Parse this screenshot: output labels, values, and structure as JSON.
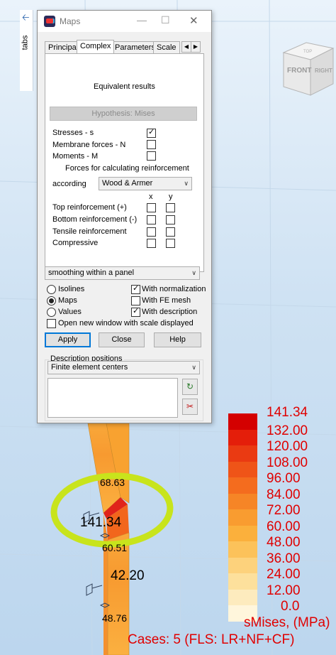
{
  "sidebar": {
    "tabs_label": "tabs"
  },
  "viewcube": {
    "front": "FRONT",
    "right": "RIGHT",
    "top": "TOP"
  },
  "window": {
    "title": "Maps"
  },
  "tabs": [
    "Principal",
    "Complex",
    "Parameters",
    "Scale"
  ],
  "complex": {
    "equivalent_results": "Equivalent results",
    "hypothesis": "Hypothesis: Mises",
    "stresses": "Stresses - s",
    "membrane": "Membrane forces - N",
    "moments": "Moments - M",
    "forces_reinf": "Forces for calculating reinforcement",
    "according": "according",
    "method": "Wood & Armer",
    "col_x": "x",
    "col_y": "y",
    "top_reinf": "Top reinforcement (+)",
    "bottom_reinf": "Bottom reinforcement (-)",
    "tensile_reinf": "Tensile reinforcement",
    "compressive": "Compressive"
  },
  "smoothing": "smoothing within a panel",
  "options": {
    "isolines": "Isolines",
    "maps": "Maps",
    "values": "Values",
    "with_normalization": "With normalization",
    "with_fe_mesh": "With FE mesh",
    "with_description": "With description",
    "open_new_window": "Open new window with scale displayed"
  },
  "buttons": {
    "apply": "Apply",
    "close": "Close",
    "help": "Help"
  },
  "description": {
    "caption": "Description positions",
    "position": "Finite element centers"
  },
  "values_on_model": {
    "v1": "68.63",
    "v2": "141.34",
    "v3": "60.51",
    "v4": "42.20",
    "v5": "48.76"
  },
  "legend": {
    "values": [
      "141.34",
      "132.00",
      "120.00",
      "108.00",
      "96.00",
      "84.00",
      "72.00",
      "60.00",
      "48.00",
      "36.00",
      "24.00",
      "12.00",
      "0.0"
    ],
    "colors": [
      "#d40000",
      "#e41e0a",
      "#ea3a12",
      "#ef5418",
      "#f46c1e",
      "#f68526",
      "#f99c30",
      "#fbb03c",
      "#fcc25a",
      "#fdd27c",
      "#fde09c",
      "#fdebbe",
      "#fff6dc"
    ],
    "title": "sMises, (MPa)",
    "cases": "Cases: 5 (FLS: LR+NF+CF)"
  },
  "colors": {
    "highlight_ring": "#c8e41c",
    "legend_text": "#e00000",
    "member": "#f6a93a"
  }
}
